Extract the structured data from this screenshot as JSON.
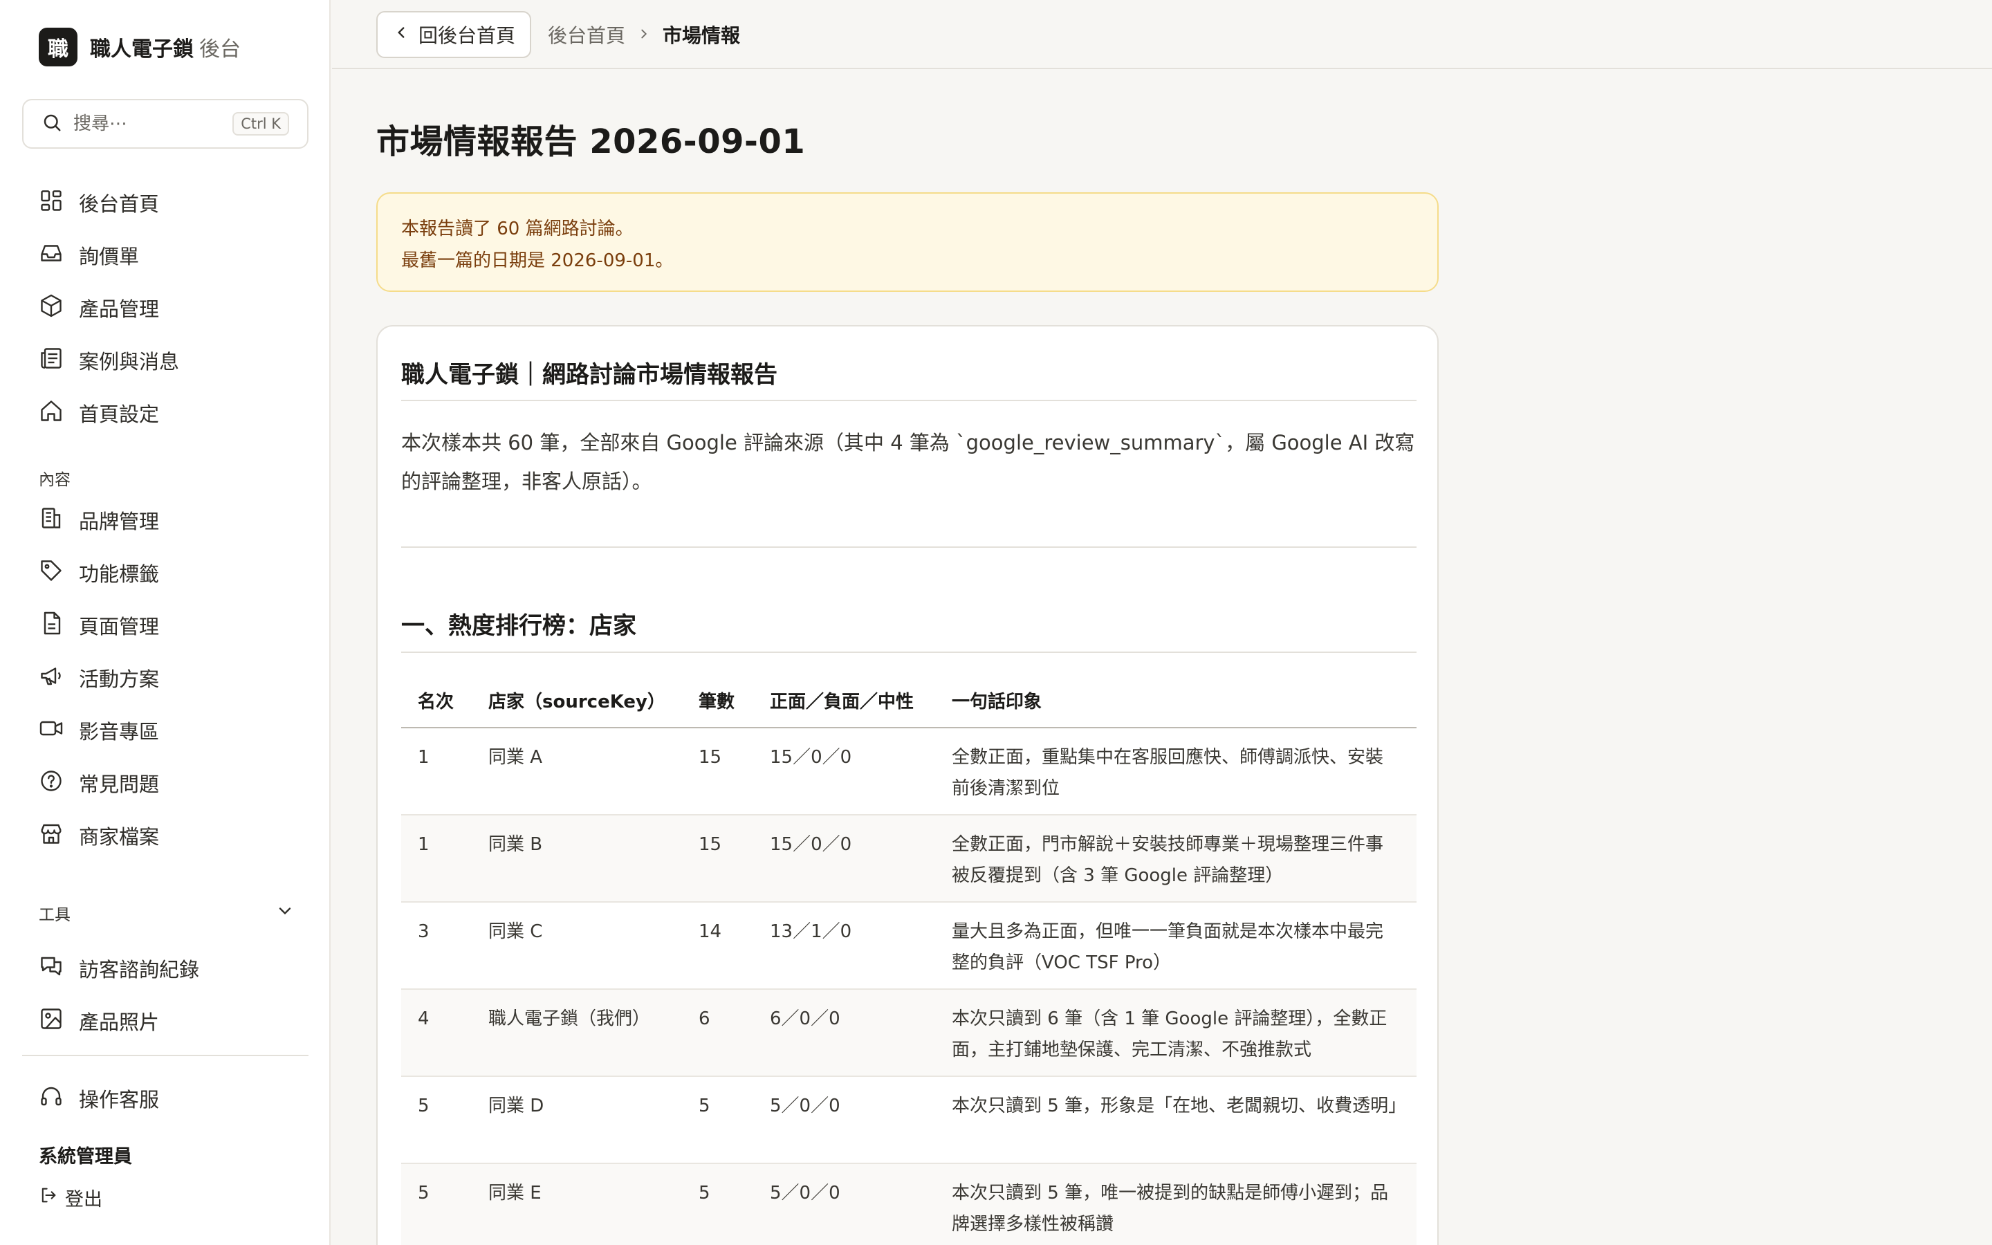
{
  "brand": {
    "logo_char": "職",
    "name": "職人電子鎖",
    "suffix": "後台"
  },
  "search": {
    "placeholder": "搜尋⋯",
    "shortcut": "Ctrl K"
  },
  "sidebar": {
    "main_items": [
      {
        "label": "後台首頁",
        "icon": "dashboard-icon"
      },
      {
        "label": "詢價單",
        "icon": "inbox-icon"
      },
      {
        "label": "產品管理",
        "icon": "box-icon"
      },
      {
        "label": "案例與消息",
        "icon": "newspaper-icon"
      },
      {
        "label": "首頁設定",
        "icon": "home-icon"
      }
    ],
    "content_section": "內容",
    "content_items": [
      {
        "label": "品牌管理",
        "icon": "building-icon"
      },
      {
        "label": "功能標籤",
        "icon": "tag-icon"
      },
      {
        "label": "頁面管理",
        "icon": "file-icon"
      },
      {
        "label": "活動方案",
        "icon": "megaphone-icon"
      },
      {
        "label": "影音專區",
        "icon": "video-icon"
      },
      {
        "label": "常見問題",
        "icon": "help-circle-icon"
      },
      {
        "label": "商家檔案",
        "icon": "store-icon"
      }
    ],
    "tools_section": "工具",
    "tools_items": [
      {
        "label": "訪客諮詢紀錄",
        "icon": "chat-icon"
      },
      {
        "label": "產品照片",
        "icon": "image-icon"
      }
    ],
    "support_item": {
      "label": "操作客服",
      "icon": "headset-icon"
    },
    "admin_label": "系統管理員",
    "logout_label": "登出"
  },
  "topbar": {
    "back_label": "回後台首頁",
    "breadcrumb_home": "後台首頁",
    "breadcrumb_current": "市場情報"
  },
  "page": {
    "title": "市場情報報告 2026-09-01",
    "notice_line1": "本報告讀了 60 篇網路討論。",
    "notice_line2": "最舊一篇的日期是 2026-09-01。",
    "report_title": "職人電子鎖｜網路討論市場情報報告",
    "intro": "本次樣本共 60 筆，全部來自 Google 評論來源（其中 4 筆為 `google_review_summary`，屬 Google AI 改寫的評論整理，非客人原話）。",
    "section_title": "一、熱度排行榜：店家"
  },
  "table": {
    "headers": [
      "名次",
      "店家（sourceKey）",
      "筆數",
      "正面／負面／中性",
      "一句話印象"
    ],
    "rows": [
      [
        "1",
        "同業 A",
        "15",
        "15／0／0",
        "全數正面，重點集中在客服回應快、師傅調派快、安裝前後清潔到位"
      ],
      [
        "1",
        "同業 B",
        "15",
        "15／0／0",
        "全數正面，門市解說＋安裝技師專業＋現場整理三件事被反覆提到（含 3 筆 Google 評論整理）"
      ],
      [
        "3",
        "同業 C",
        "14",
        "13／1／0",
        "量大且多為正面，但唯一一筆負面就是本次樣本中最完整的負評（VOC TSF Pro）"
      ],
      [
        "4",
        "職人電子鎖（我們）",
        "6",
        "6／0／0",
        "本次只讀到 6 筆（含 1 筆 Google 評論整理），全數正面，主打鋪地墊保護、完工清潔、不強推款式"
      ],
      [
        "5",
        "同業 D",
        "5",
        "5／0／0",
        "本次只讀到 5 筆，形象是「在地、老闆親切、收費透明」"
      ],
      [
        "5",
        "同業 E",
        "5",
        "5／0／0",
        "本次只讀到 5 筆，唯一被提到的缺點是師傅小遲到；品牌選擇多樣性被稱讚"
      ]
    ]
  }
}
